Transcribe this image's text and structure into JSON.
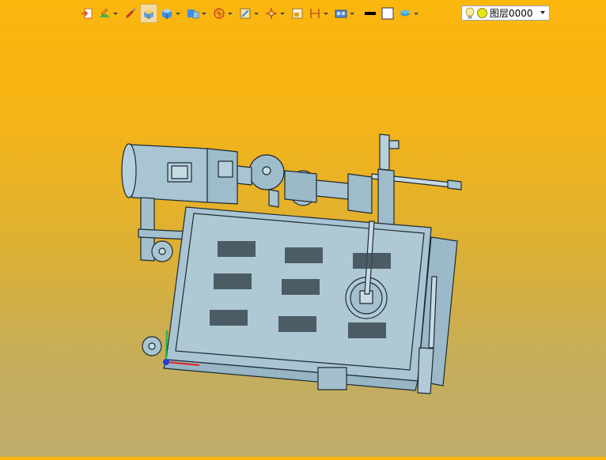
{
  "toolbar": {
    "buttons": [
      {
        "name": "exit-sketch-icon",
        "dropdown": false
      },
      {
        "name": "sketch-tools-icon",
        "dropdown": true
      },
      {
        "name": "brush-icon",
        "dropdown": false
      },
      {
        "name": "shaded-view-icon",
        "dropdown": false,
        "active": true
      },
      {
        "name": "solid-box-icon",
        "dropdown": true
      },
      {
        "name": "display-mode-icon",
        "dropdown": true
      },
      {
        "name": "view-orient-icon",
        "dropdown": true
      },
      {
        "name": "section-view-icon",
        "dropdown": true
      },
      {
        "name": "snap-point-icon",
        "dropdown": true
      },
      {
        "name": "frame-icon",
        "dropdown": false
      },
      {
        "name": "measure-icon",
        "dropdown": true
      },
      {
        "name": "render-icon",
        "dropdown": true
      },
      {
        "name": "line-color-icon",
        "dropdown": false
      },
      {
        "name": "fill-color-icon",
        "dropdown": false
      },
      {
        "name": "layer-stack-icon",
        "dropdown": true
      }
    ]
  },
  "layer": {
    "current": "图层0000",
    "colors": {
      "bulb": "#f7f0a0",
      "dot": "#e6e61a"
    }
  },
  "colors": {
    "part_fill": "#a9c4d2",
    "part_stroke": "#1d2b33",
    "axis_x": "#e3201b",
    "axis_y": "#19b34a",
    "axis_z": "#1f3fd6"
  }
}
